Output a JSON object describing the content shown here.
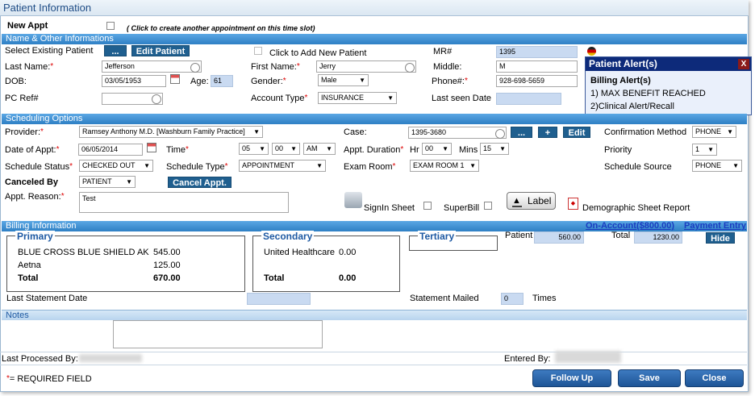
{
  "title": "Patient Information",
  "new_appt": {
    "label": "New Appt",
    "hint": "( Click to create another appointment on this time slot)"
  },
  "sections": {
    "name": "Name & Other Informations",
    "scheduling": "Scheduling Options",
    "billing": "Billing Information",
    "notes": "Notes"
  },
  "patient": {
    "select_existing_label": "Select Existing Patient",
    "browse_label": "...",
    "edit_patient_label": "Edit Patient",
    "add_new_label": "Click to Add New Patient",
    "mr_label": "MR#",
    "mr_value": "1395",
    "last_name_label": "Last Name:",
    "last_name": "Jefferson",
    "first_name_label": "First Name:",
    "first_name": "Jerry",
    "middle_label": "Middle:",
    "middle": "M",
    "dob_label": "DOB:",
    "dob": "03/05/1953",
    "age_label": "Age:",
    "age": "61",
    "gender_label": "Gender:",
    "gender": "Male",
    "phone_label": "Phone#:",
    "phone": "928-698-5659",
    "pcref_label": "PC Ref#",
    "account_type_label": "Account Type",
    "account_type": "INSURANCE",
    "last_seen_label": "Last seen Date"
  },
  "alert": {
    "title": "Patient Alert(s)",
    "close": "X",
    "heading": "Billing Alert(s)",
    "items": [
      "1) MAX BENEFIT REACHED",
      "2)Clinical Alert/Recall"
    ]
  },
  "scheduling": {
    "provider_label": "Provider:",
    "provider": "Ramsey Anthony M.D. [Washburn Family Practice]",
    "case_label": "Case:",
    "case": "1395-3680",
    "case_browse": "...",
    "case_add": "+",
    "case_edit": "Edit",
    "confirmation_label": "Confirmation Method",
    "confirmation": "PHONE",
    "date_label": "Date of Appt:",
    "date": "06/05/2014",
    "time_label": "Time",
    "time_h": "05",
    "time_m": "00",
    "time_ampm": "AM",
    "duration_label": "Appt. Duration",
    "hr_label": "Hr",
    "hr": "00",
    "mins_label": "Mins",
    "mins": "15",
    "priority_label": "Priority",
    "priority": "1",
    "status_label": "Schedule Status",
    "status": "CHECKED OUT",
    "type_label": "Schedule Type",
    "type": "APPOINTMENT",
    "room_label": "Exam Room",
    "room": "EXAM ROOM 1",
    "source_label": "Schedule Source",
    "source": "PHONE",
    "canceled_label": "Canceled By",
    "canceled": "PATIENT",
    "cancel_btn": "Cancel Appt.",
    "reason_label": "Appt. Reason:",
    "reason": "Test",
    "signin_label": "SignIn Sheet",
    "superbill_label": "SuperBill",
    "label_btn": "Label",
    "demographic_label": "Demographic Sheet Report"
  },
  "billing": {
    "on_account": "On-Account($800.00)",
    "payment_entry": "Payment Entry",
    "hide": "Hide",
    "patient_label": "Patient",
    "patient_value": "560.00",
    "total_label": "Total",
    "total_value": "1230.00",
    "primary": {
      "title": "Primary",
      "rows": [
        {
          "name": "BLUE CROSS BLUE SHIELD AK",
          "amount": "545.00"
        },
        {
          "name": "Aetna",
          "amount": "125.00"
        }
      ],
      "total_label": "Total",
      "total": "670.00"
    },
    "secondary": {
      "title": "Secondary",
      "rows": [
        {
          "name": "United Healthcare",
          "amount": "0.00"
        }
      ],
      "total_label": "Total",
      "total": "0.00"
    },
    "tertiary": {
      "title": "Tertiary"
    },
    "last_statement_label": "Last Statement Date",
    "statement_mailed_label": "Statement Mailed",
    "statement_mailed": "0",
    "times_label": "Times"
  },
  "footer": {
    "last_processed_label": "Last Processed By:",
    "entered_by_label": "Entered By:",
    "required_note": "= REQUIRED FIELD",
    "follow_up": "Follow Up",
    "save": "Save",
    "close": "Close"
  }
}
